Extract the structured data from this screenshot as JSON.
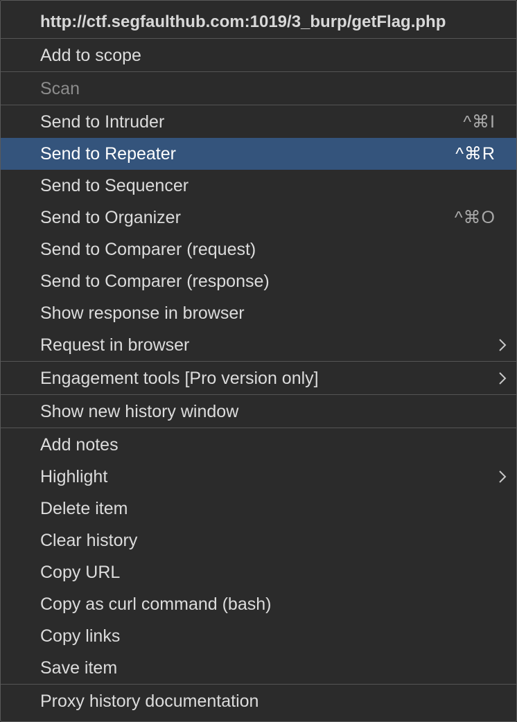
{
  "menu": {
    "header": "http://ctf.segfaulthub.com:1019/3_burp/getFlag.php",
    "add_to_scope": "Add to scope",
    "scan": "Scan",
    "send_to_intruder": "Send to Intruder",
    "send_to_intruder_shortcut": "^⌘I",
    "send_to_repeater": "Send to Repeater",
    "send_to_repeater_shortcut": "^⌘R",
    "send_to_sequencer": "Send to Sequencer",
    "send_to_organizer": "Send to Organizer",
    "send_to_organizer_shortcut": "^⌘O",
    "send_to_comparer_request": "Send to Comparer (request)",
    "send_to_comparer_response": "Send to Comparer (response)",
    "show_response_in_browser": "Show response in browser",
    "request_in_browser": "Request in browser",
    "engagement_tools": "Engagement tools [Pro version only]",
    "show_new_history_window": "Show new history window",
    "add_notes": "Add notes",
    "highlight": "Highlight",
    "delete_item": "Delete item",
    "clear_history": "Clear history",
    "copy_url": "Copy URL",
    "copy_as_curl": "Copy as curl command (bash)",
    "copy_links": "Copy links",
    "save_item": "Save item",
    "proxy_history_documentation": "Proxy history documentation"
  },
  "icons": {
    "submenu": "chevron-right-icon"
  },
  "colors": {
    "background": "#2b2b2b",
    "selected": "#34547c",
    "separator": "#555555",
    "text": "#dcdcdc",
    "disabled_text": "#8c8c8c"
  }
}
